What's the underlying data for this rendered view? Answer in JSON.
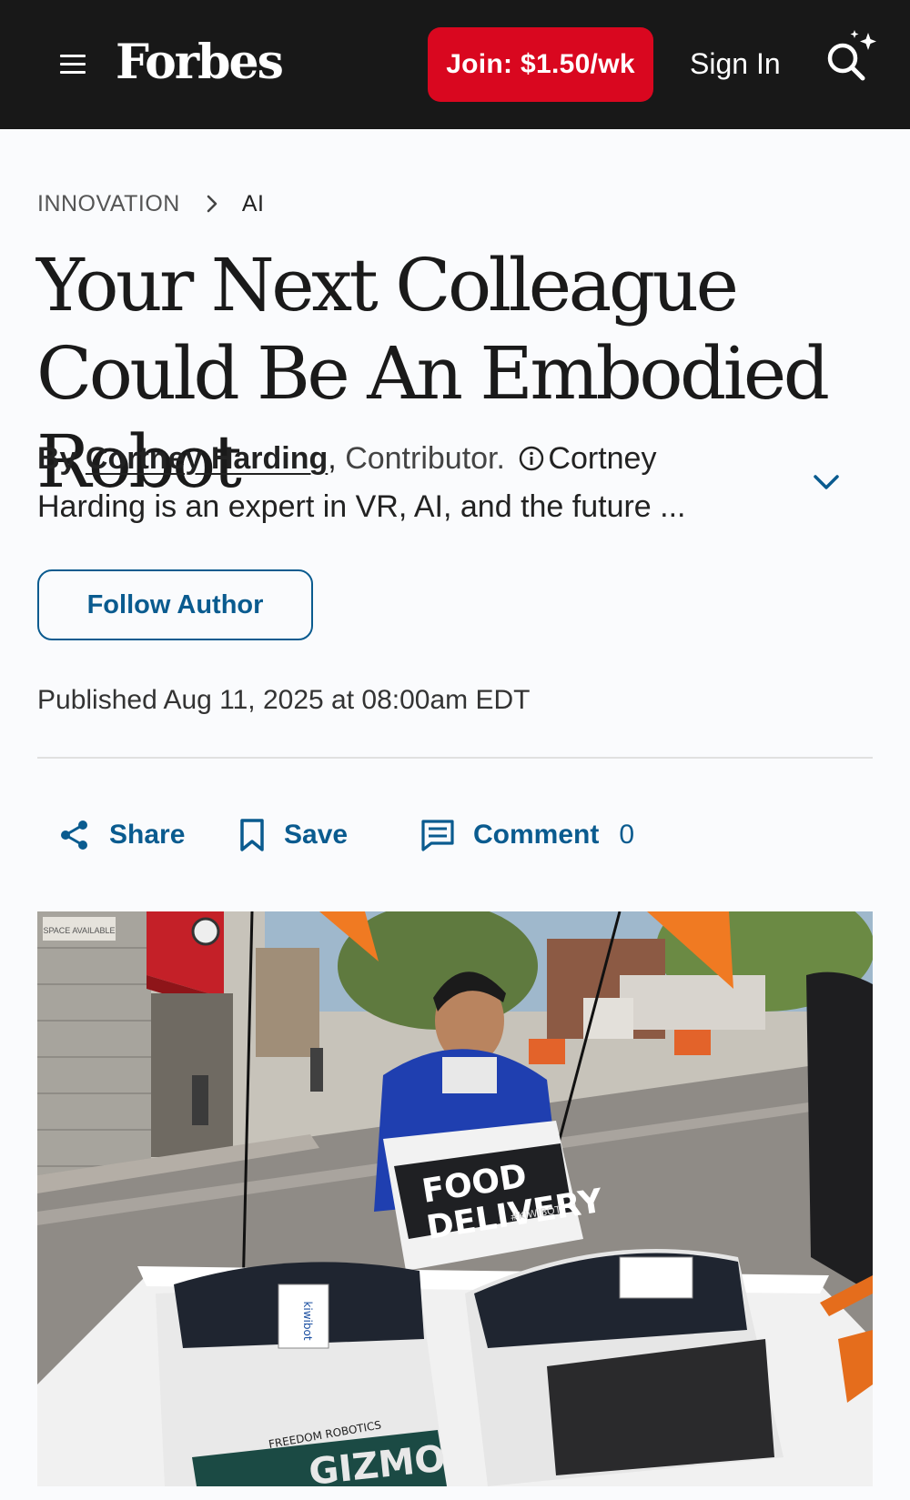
{
  "header": {
    "logo": "Forbes",
    "join_label": "Join: $1.50/wk",
    "signin_label": "Sign In",
    "menu_icon": "hamburger-menu-icon",
    "search_icon": "ai-search-icon"
  },
  "breadcrumb": {
    "section": "INNOVATION",
    "subsection": "AI"
  },
  "article": {
    "headline": "Your Next Colleague Could Be An Embodied Robot",
    "byline": {
      "by": "By",
      "author": "Cortney Harding",
      "separator": ",",
      "role": "Contributor.",
      "bio": "Cortney Harding is an expert in VR, AI, and the future ..."
    },
    "follow_label": "Follow Author",
    "published": "Published Aug 11, 2025 at 08:00am EDT"
  },
  "actions": {
    "share_label": "Share",
    "save_label": "Save",
    "comment_label": "Comment",
    "comment_count": "0"
  },
  "hero_image": {
    "cooler_text_line1": "FOOD",
    "cooler_text_line2": "DELIVERY",
    "cooler_brand": "#KIWIBOT",
    "box_brand": "kiwibot",
    "box_text": "FREEDOM ROBOTICS",
    "box_name": "GIZMO",
    "store_sign": "SPACE AVAILABLE"
  },
  "colors": {
    "topbar_bg": "#181818",
    "join_button": "#d9071f",
    "accent_link": "#0a5b8f",
    "page_bg": "#fafbfd"
  }
}
